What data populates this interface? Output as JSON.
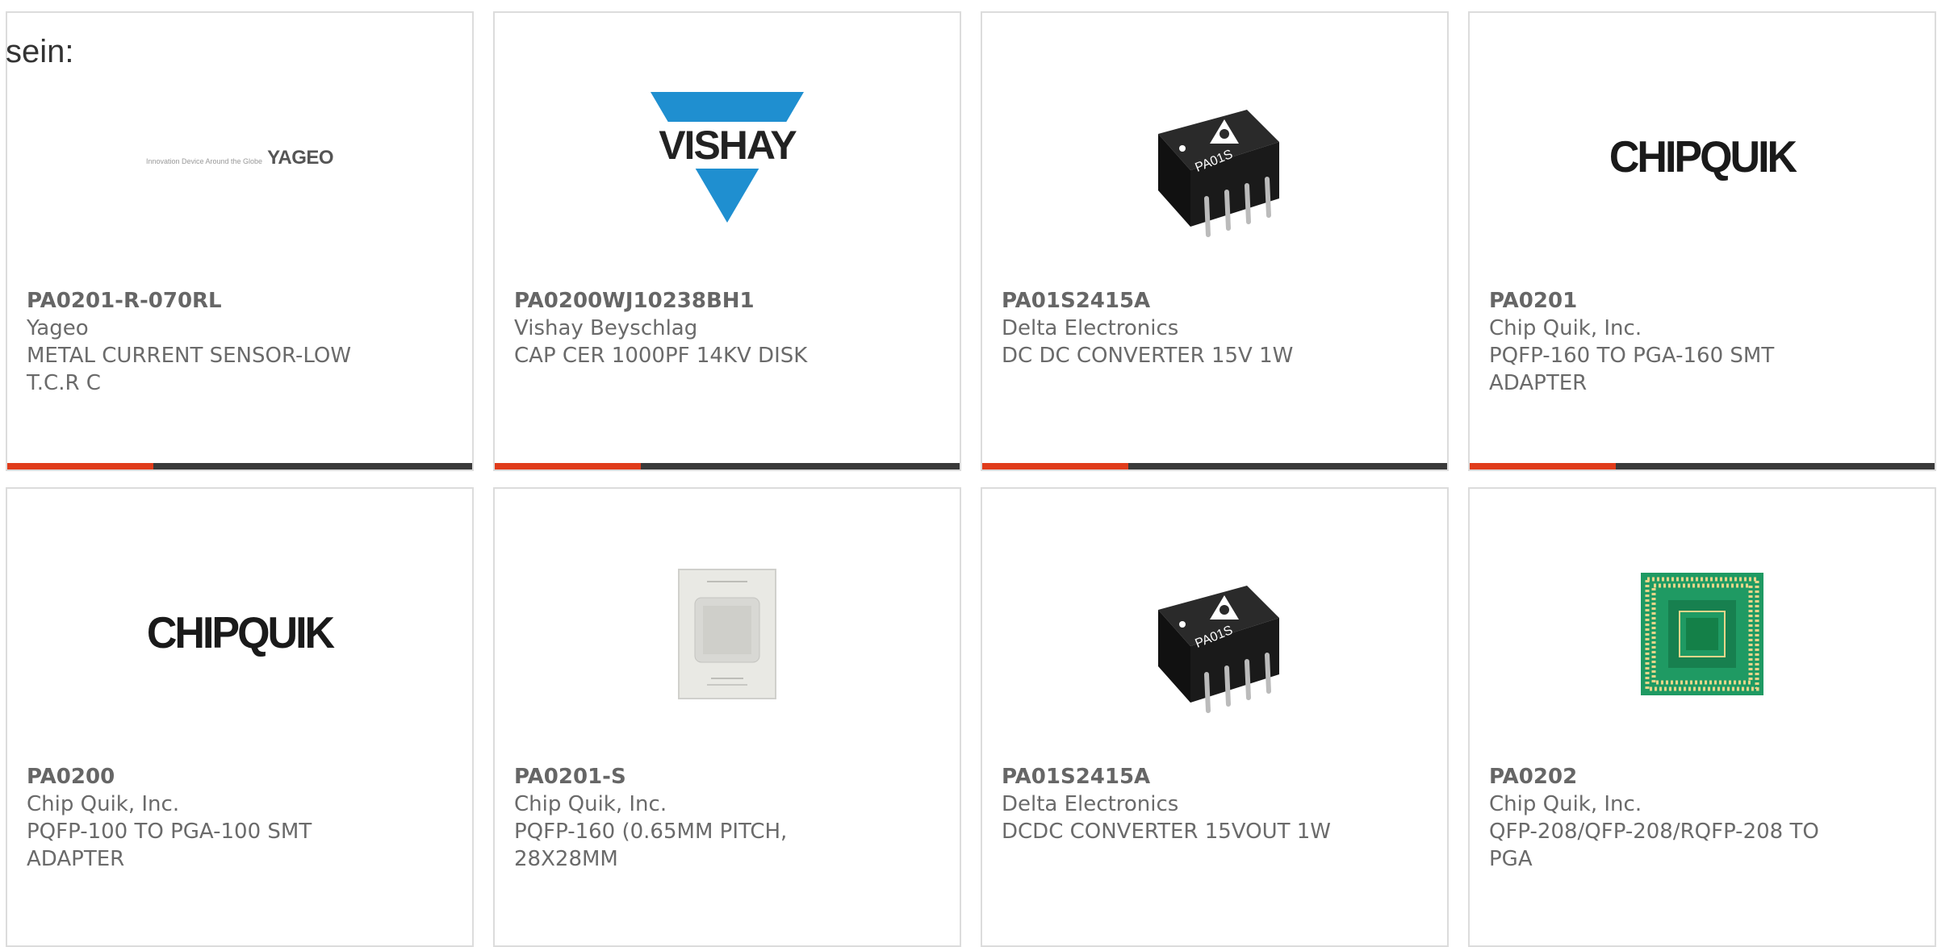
{
  "intro_text": "sein:",
  "products": [
    {
      "part": "PA0201-R-070RL",
      "manufacturer": "Yageo",
      "description_lines": [
        "METAL CURRENT SENSOR-LOW",
        "T.C.R C"
      ],
      "image": "yageo-logo",
      "logo_text": "YAGEO",
      "logo_tagline": "Innovation Device Around the Globe"
    },
    {
      "part": "PA0200WJ10238BH1",
      "manufacturer": "Vishay Beyschlag",
      "description_lines": [
        "CAP CER 1000PF 14KV DISK"
      ],
      "image": "vishay-logo",
      "logo_text": "VISHAY"
    },
    {
      "part": "PA01S2415A",
      "manufacturer": "Delta Electronics",
      "description_lines": [
        "DC DC CONVERTER 15V 1W"
      ],
      "image": "dc-converter-module-photo",
      "module_marking": "PA01S"
    },
    {
      "part": "PA0201",
      "manufacturer": "Chip Quik, Inc.",
      "description_lines": [
        "PQFP-160 TO PGA-160 SMT",
        "ADAPTER"
      ],
      "image": "chipquik-logo",
      "logo_text": "CHIPQUIK"
    },
    {
      "part": "PA0200",
      "manufacturer": "Chip Quik, Inc.",
      "description_lines": [
        "PQFP-100 TO PGA-100 SMT",
        "ADAPTER"
      ],
      "image": "chipquik-logo",
      "logo_text": "CHIPQUIK"
    },
    {
      "part": "PA0201-S",
      "manufacturer": "Chip Quik, Inc.",
      "description_lines": [
        "PQFP-160 (0.65MM PITCH,",
        "28X28MM"
      ],
      "image": "stencil-photo"
    },
    {
      "part": "PA01S2415A",
      "manufacturer": "Delta Electronics",
      "description_lines": [
        "DCDC CONVERTER 15VOUT 1W"
      ],
      "image": "dc-converter-module-photo",
      "module_marking": "PA01S"
    },
    {
      "part": "PA0202",
      "manufacturer": "Chip Quik, Inc.",
      "description_lines": [
        "QFP-208/QFP-208/RQFP-208 TO",
        "PGA"
      ],
      "image": "adapter-board-photo"
    }
  ],
  "colors": {
    "accent_bar": "#e03c1b",
    "dark_bar": "#3a3a3a",
    "card_border": "#dcdcdc",
    "vishay_blue": "#1f8fd0",
    "pcb_green": "#1f9a63"
  }
}
